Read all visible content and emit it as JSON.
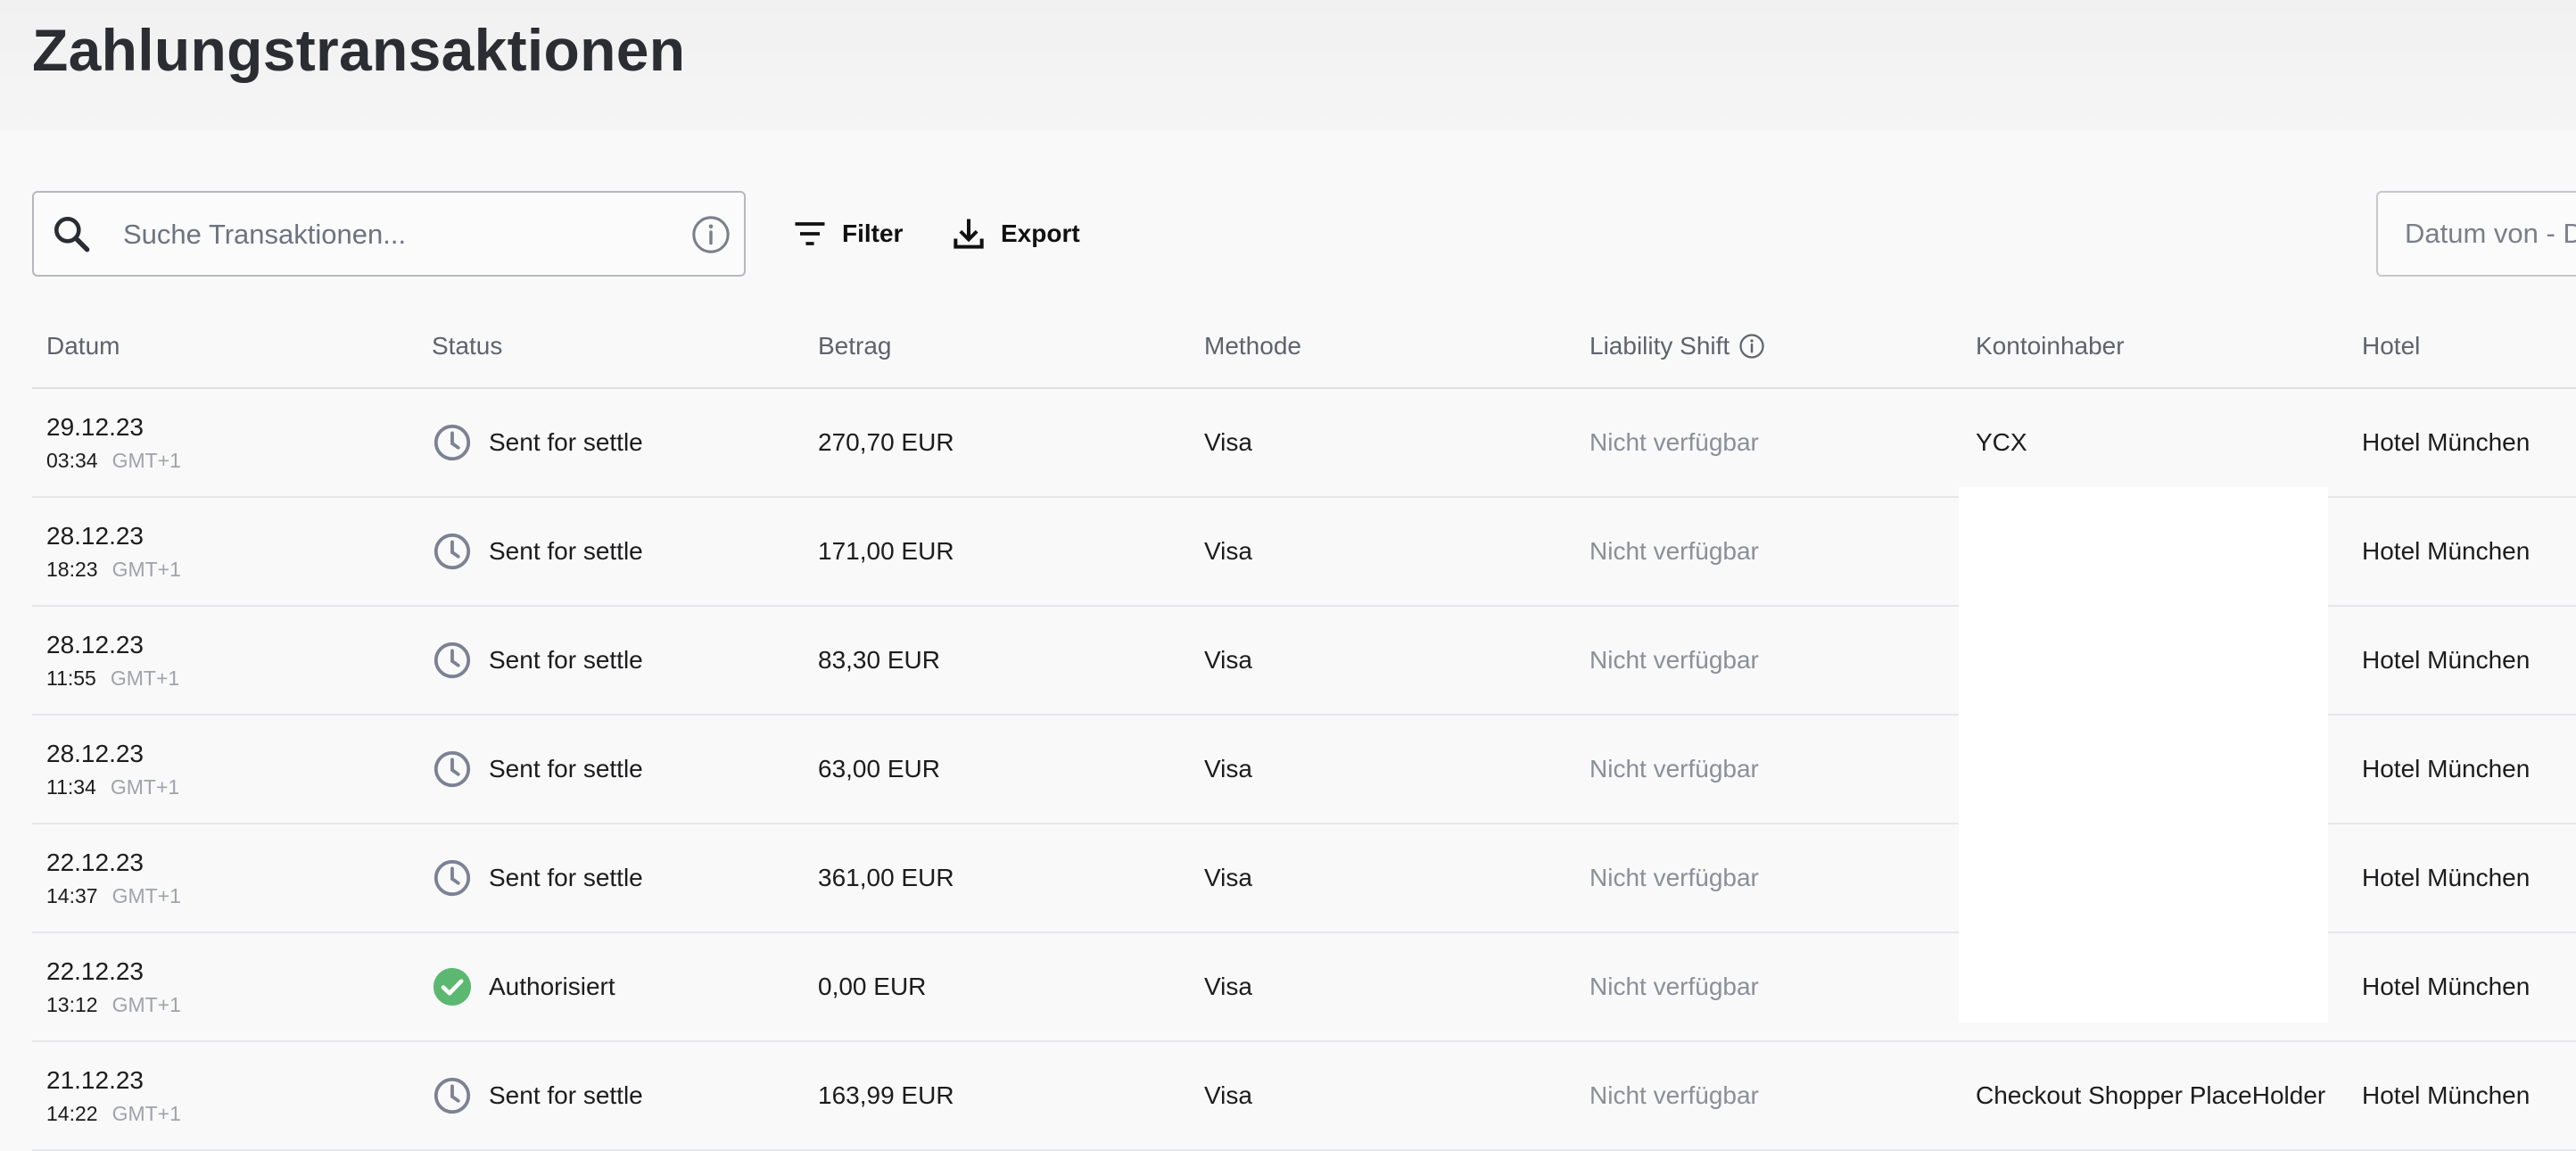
{
  "page": {
    "title": "Zahlungstransaktionen"
  },
  "toolbar": {
    "search_placeholder": "Suche Transaktionen...",
    "filter_label": "Filter",
    "export_label": "Export",
    "date_placeholder": "Datum von - D"
  },
  "table": {
    "columns": [
      "Datum",
      "Status",
      "Betrag",
      "Methode",
      "Liability Shift",
      "Kontoinhaber",
      "Hotel"
    ],
    "rows": [
      {
        "date": "29.12.23",
        "time": "03:34",
        "tz": "GMT+1",
        "status": "Sent for settle",
        "status_type": "pending",
        "amount": "270,70 EUR",
        "method": "Visa",
        "liability": "Nicht verfügbar",
        "holder": "YCX",
        "hotel": "Hotel München"
      },
      {
        "date": "28.12.23",
        "time": "18:23",
        "tz": "GMT+1",
        "status": "Sent for settle",
        "status_type": "pending",
        "amount": "171,00 EUR",
        "method": "Visa",
        "liability": "Nicht verfügbar",
        "holder": "",
        "hotel": "Hotel München"
      },
      {
        "date": "28.12.23",
        "time": "11:55",
        "tz": "GMT+1",
        "status": "Sent for settle",
        "status_type": "pending",
        "amount": "83,30 EUR",
        "method": "Visa",
        "liability": "Nicht verfügbar",
        "holder": "",
        "hotel": "Hotel München"
      },
      {
        "date": "28.12.23",
        "time": "11:34",
        "tz": "GMT+1",
        "status": "Sent for settle",
        "status_type": "pending",
        "amount": "63,00 EUR",
        "method": "Visa",
        "liability": "Nicht verfügbar",
        "holder": "",
        "hotel": "Hotel München"
      },
      {
        "date": "22.12.23",
        "time": "14:37",
        "tz": "GMT+1",
        "status": "Sent for settle",
        "status_type": "pending",
        "amount": "361,00 EUR",
        "method": "Visa",
        "liability": "Nicht verfügbar",
        "holder": "",
        "hotel": "Hotel München"
      },
      {
        "date": "22.12.23",
        "time": "13:12",
        "tz": "GMT+1",
        "status": "Authorisiert",
        "status_type": "authorized",
        "amount": "0,00 EUR",
        "method": "Visa",
        "liability": "Nicht verfügbar",
        "holder": "",
        "hotel": "Hotel München"
      },
      {
        "date": "21.12.23",
        "time": "14:22",
        "tz": "GMT+1",
        "status": "Sent for settle",
        "status_type": "pending",
        "amount": "163,99 EUR",
        "method": "Visa",
        "liability": "Nicht verfügbar",
        "holder": "Checkout Shopper PlaceHolder",
        "hotel": "Hotel München"
      }
    ]
  },
  "colors": {
    "pending_icon": "#7c8294",
    "authorized_icon": "#5cb870",
    "muted_text": "#8a8f99"
  }
}
